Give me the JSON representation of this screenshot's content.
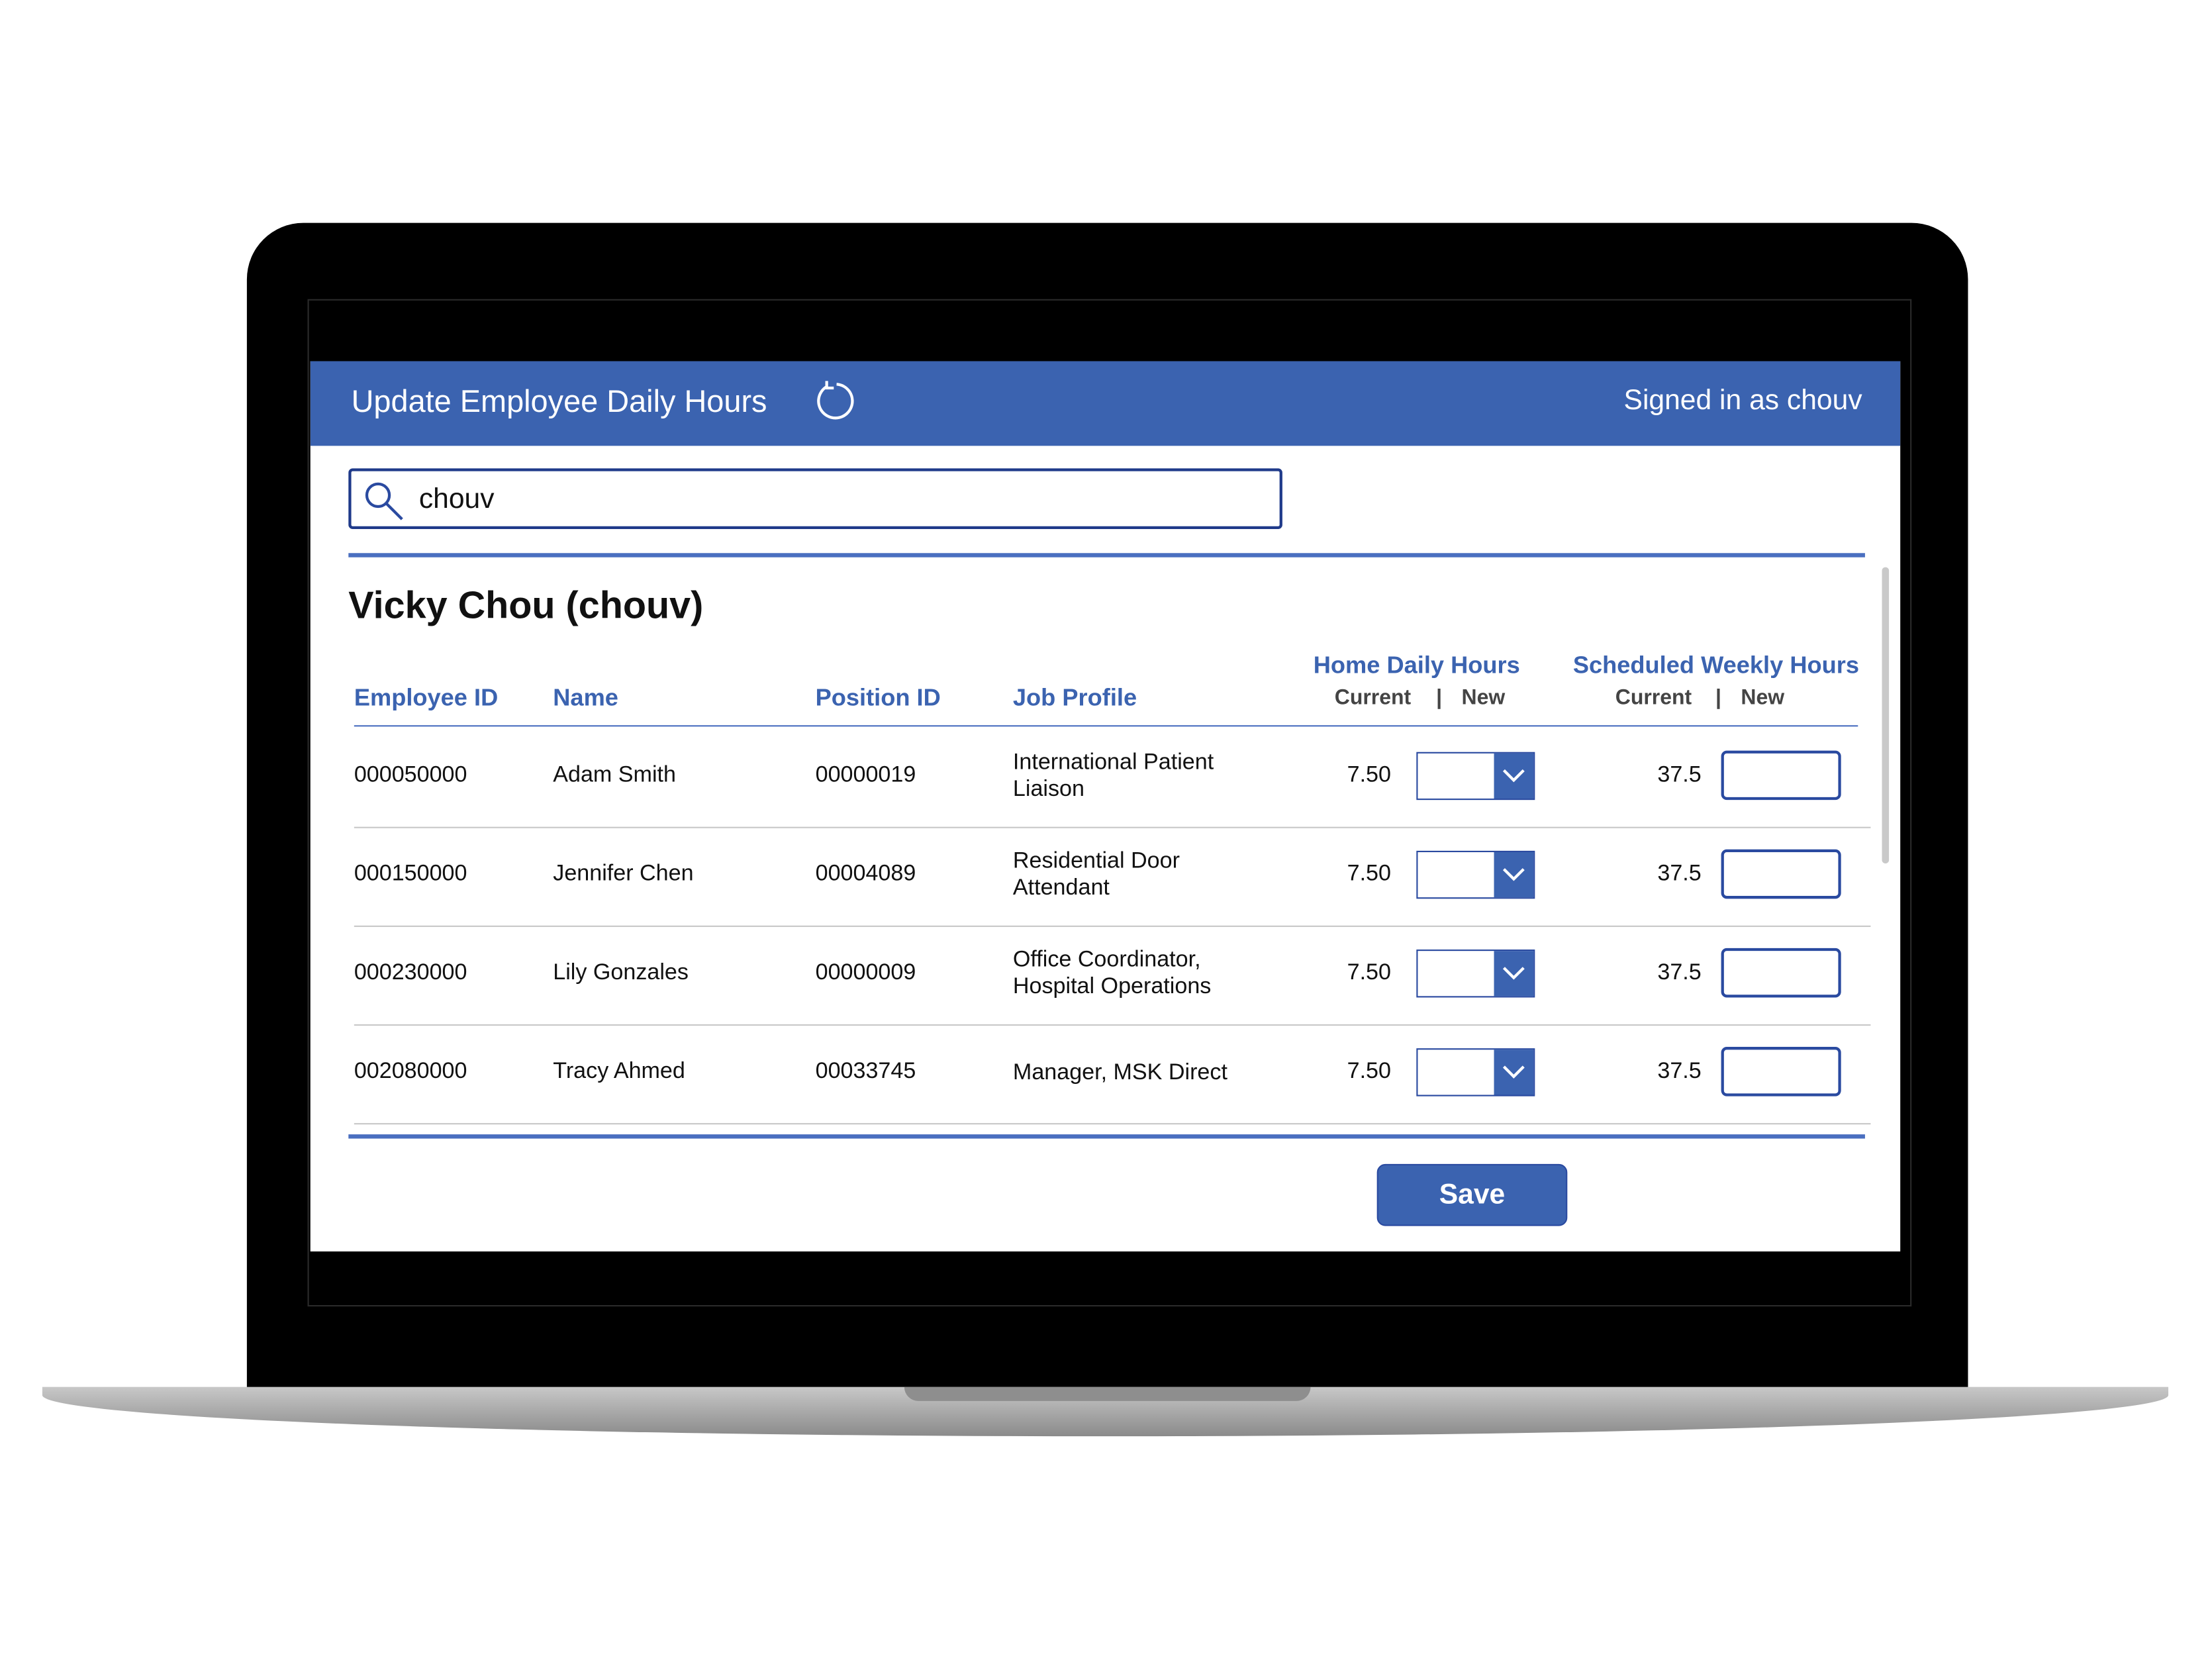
{
  "header": {
    "title": "Update Employee Daily Hours",
    "signed_in": "Signed in as chouv"
  },
  "search": {
    "value": "chouv"
  },
  "person_title": "Vicky Chou (chouv)",
  "columns": {
    "employee_id": "Employee ID",
    "name": "Name",
    "position_id": "Position ID",
    "job_profile": "Job Profile",
    "home_daily_hours": "Home Daily Hours",
    "scheduled_weekly_hours": "Scheduled Weekly Hours",
    "current": "Current",
    "divider": "|",
    "new": "New"
  },
  "rows": [
    {
      "employee_id": "000050000",
      "name": "Adam Smith",
      "position_id": "00000019",
      "job_profile_1": "International Patient",
      "job_profile_2": "Liaison",
      "daily_current": "7.50",
      "weekly_current": "37.5"
    },
    {
      "employee_id": "000150000",
      "name": "Jennifer Chen",
      "position_id": "00004089",
      "job_profile_1": "Residential Door",
      "job_profile_2": "Attendant",
      "daily_current": "7.50",
      "weekly_current": "37.5"
    },
    {
      "employee_id": "000230000",
      "name": "Lily Gonzales",
      "position_id": "00000009",
      "job_profile_1": "Office Coordinator,",
      "job_profile_2": "Hospital Operations",
      "daily_current": "7.50",
      "weekly_current": "37.5"
    },
    {
      "employee_id": "002080000",
      "name": "Tracy Ahmed",
      "position_id": "00033745",
      "job_profile_1": "Manager, MSK Direct",
      "job_profile_2": "",
      "daily_current": "7.50",
      "weekly_current": "37.5"
    }
  ],
  "save_label": "Save",
  "colors": {
    "brand": "#3b63b0",
    "border": "#1f3a8a"
  }
}
